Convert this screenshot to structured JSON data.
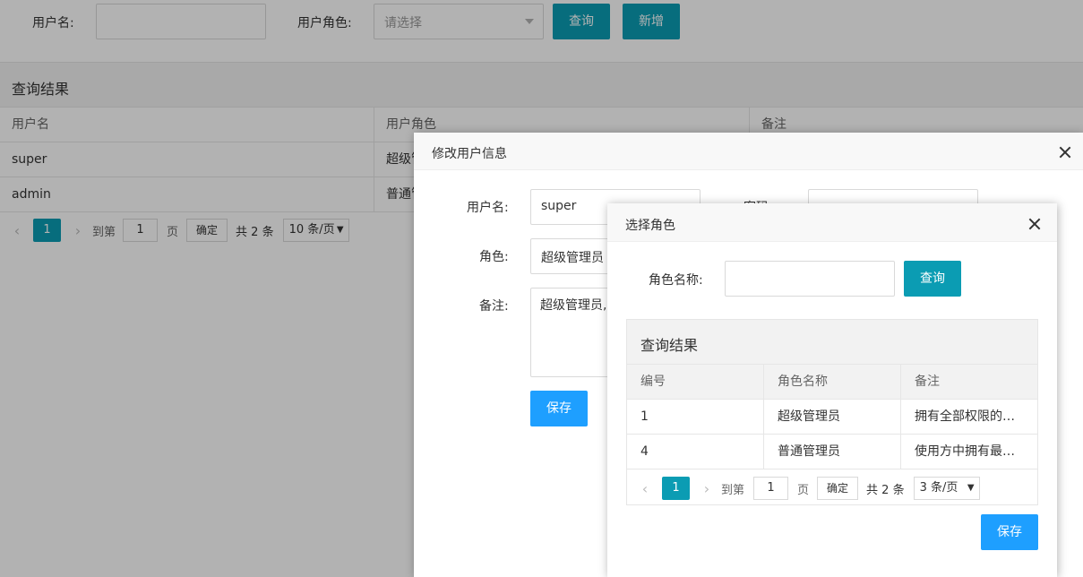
{
  "search": {
    "username_label": "用户名:",
    "username_value": "",
    "role_label": "用户角色:",
    "role_placeholder": "请选择",
    "query_button": "查询",
    "add_button": "新增"
  },
  "results": {
    "title": "查询结果",
    "columns": [
      "用户名",
      "用户角色",
      "备注"
    ],
    "rows": [
      {
        "username": "super",
        "role": "超级管理员"
      },
      {
        "username": "admin",
        "role": "普通管理员"
      }
    ],
    "pager": {
      "current": "1",
      "goto_prefix": "到第",
      "goto_value": "1",
      "goto_suffix": "页",
      "confirm": "确定",
      "total": "共 2 条",
      "page_size": "10 条/页"
    }
  },
  "edit_dialog": {
    "title": "修改用户信息",
    "username_label": "用户名:",
    "username_value": "super",
    "password_label": "密码:",
    "role_label": "角色:",
    "role_value": "超级管理员",
    "remark_label": "备注:",
    "remark_value": "超级管理员,",
    "save_button": "保存"
  },
  "role_dialog": {
    "title": "选择角色",
    "role_name_label": "角色名称:",
    "role_name_value": "",
    "query_button": "查询",
    "results_title": "查询结果",
    "columns": [
      "编号",
      "角色名称",
      "备注"
    ],
    "rows": [
      {
        "id": "1",
        "name": "超级管理员",
        "remark": "拥有全部权限的…"
      },
      {
        "id": "4",
        "name": "普通管理员",
        "remark": "使用方中拥有最…"
      }
    ],
    "pager": {
      "current": "1",
      "goto_prefix": "到第",
      "goto_value": "1",
      "goto_suffix": "页",
      "confirm": "确定",
      "total": "共 2 条",
      "page_size": "3 条/页"
    },
    "save_button": "保存"
  },
  "colors": {
    "teal": "#0b9cb3",
    "blue": "#1e9fff",
    "shade": "rgba(0,0,0,0.30)"
  }
}
